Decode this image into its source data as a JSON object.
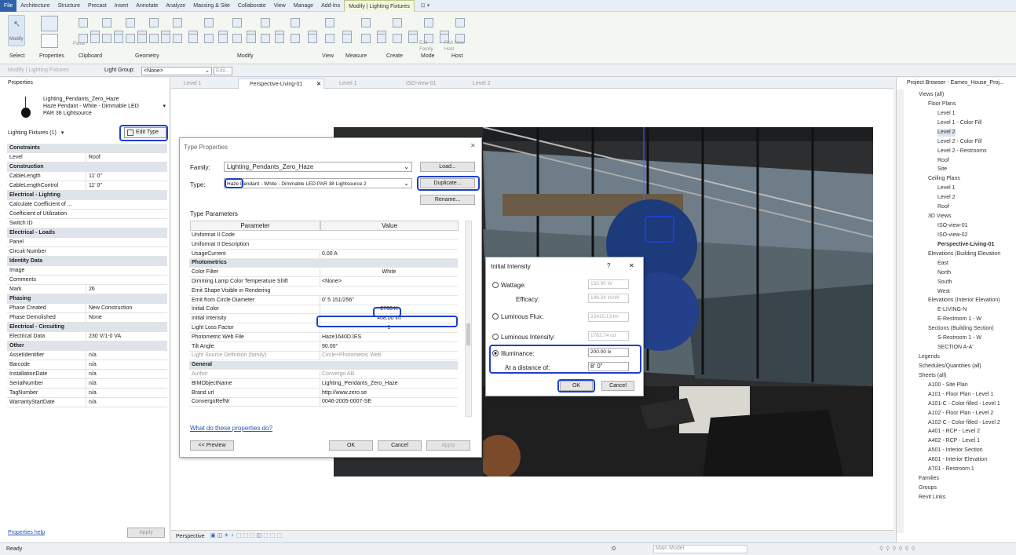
{
  "ribbon": {
    "tabs": [
      "File",
      "Architecture",
      "Structure",
      "Precast",
      "Insert",
      "Annotate",
      "Analyze",
      "Massing & Site",
      "Collaborate",
      "View",
      "Manage",
      "Add-Ins",
      "Modify | Lighting Fixtures"
    ],
    "panels": [
      "Select",
      "Properties",
      "Clipboard",
      "Geometry",
      "Modify",
      "View",
      "Measure",
      "Create",
      "Mode",
      "Host"
    ],
    "modify_label": "Modify",
    "paste_label": "Paste",
    "cope_label": "Cope",
    "cut_label": "Cut",
    "join_label": "Join",
    "edit_family_label": "Edit Family",
    "pick_host_label": "Pick New Host"
  },
  "optbar": {
    "context": "Modify | Lighting Fixtures",
    "light_group_label": "Light Group:",
    "light_group_value": "<None>",
    "edit_label": "Edit..."
  },
  "properties": {
    "title": "Properties",
    "family_line1": "Lighting_Pendants_Zero_Haze",
    "family_line2": "Haze Pendant - White - Dimmable LED",
    "family_line3": "PAR 38 Lightsource",
    "filter": "Lighting Fixtures (1)",
    "edit_type": "Edit Type",
    "rows": [
      {
        "k": "Constraints",
        "g": true
      },
      {
        "k": "Level",
        "v": "Roof"
      },
      {
        "k": "Construction",
        "g": true
      },
      {
        "k": "CableLength",
        "v": "11'  0\""
      },
      {
        "k": "CableLengthControl",
        "v": "11'  0\""
      },
      {
        "k": "Electrical - Lighting",
        "g": true
      },
      {
        "k": "Calculate Coefficient of ...",
        "v": ""
      },
      {
        "k": "Coefficient of Utilization",
        "v": ""
      },
      {
        "k": "Switch ID",
        "v": ""
      },
      {
        "k": "Electrical - Loads",
        "g": true
      },
      {
        "k": "Panel",
        "v": ""
      },
      {
        "k": "Circuit Number",
        "v": ""
      },
      {
        "k": "Identity Data",
        "g": true
      },
      {
        "k": "Image",
        "v": ""
      },
      {
        "k": "Comments",
        "v": ""
      },
      {
        "k": "Mark",
        "v": "26"
      },
      {
        "k": "Phasing",
        "g": true
      },
      {
        "k": "Phase Created",
        "v": "New Construction"
      },
      {
        "k": "Phase Demolished",
        "v": "None"
      },
      {
        "k": "Electrical - Circuiting",
        "g": true
      },
      {
        "k": "Electrical Data",
        "v": "230 V/1-0 VA"
      },
      {
        "k": "Other",
        "g": true
      },
      {
        "k": "AssetIdentifier",
        "v": "n/a"
      },
      {
        "k": "Barcode",
        "v": "n/a"
      },
      {
        "k": "InstallationDate",
        "v": "n/a"
      },
      {
        "k": "SerialNumber",
        "v": "n/a"
      },
      {
        "k": "TagNumber",
        "v": "n/a"
      },
      {
        "k": "WarrantyStartDate",
        "v": "n/a"
      }
    ],
    "help": "Properties help",
    "apply": "Apply"
  },
  "view_tabs": [
    "Level 1",
    "Perspective-Living-01",
    "Level 1",
    "ISO-view-01",
    "Level 2"
  ],
  "type_props": {
    "title": "Type Properties",
    "family_label": "Family:",
    "family_value": "Lighting_Pendants_Zero_Haze",
    "type_label": "Type:",
    "type_value": "Haze Pendant - White - Dimmable LED PAR 38 Lightsource 2",
    "load": "Load...",
    "duplicate": "Duplicate...",
    "rename": "Rename...",
    "params_label": "Type Parameters",
    "col_param": "Parameter",
    "col_value": "Value",
    "rows": [
      {
        "k": "Uniformat II Code",
        "v": ""
      },
      {
        "k": "Uniformat II Description",
        "v": ""
      },
      {
        "k": "UsageCurrent",
        "v": "0.00 A"
      },
      {
        "k": "Photometrics",
        "v": "",
        "g": true
      },
      {
        "k": "Color Filter",
        "v": "White"
      },
      {
        "k": "Dimming Lamp Color Temperature Shift",
        "v": "<None>"
      },
      {
        "k": "Emit Shape Visible in Rendering",
        "v": ""
      },
      {
        "k": "Emit from Circle Diameter",
        "v": "0'  5 151/256\""
      },
      {
        "k": "Initial Color",
        "v": "2700 K"
      },
      {
        "k": "Initial Intensity",
        "v": "468.00 lm"
      },
      {
        "k": "Light Loss Factor",
        "v": "1"
      },
      {
        "k": "Photometric Web File",
        "v": "Haze1640D.IES"
      },
      {
        "k": "Tilt Angle",
        "v": "90.00°"
      },
      {
        "k": "Light Source Definition (family)",
        "v": "Circle+Photometric Web",
        "d": true
      },
      {
        "k": "General",
        "v": "",
        "g": true
      },
      {
        "k": "Author",
        "v": "Convergo AB",
        "d": true
      },
      {
        "k": "BIMObjectName",
        "v": "Lighting_Pendants_Zero_Haze"
      },
      {
        "k": "Brand url",
        "v": "http://www.zero.se"
      },
      {
        "k": "ConvergoRefNr",
        "v": "0046-2005-0007-SE"
      }
    ],
    "what_link": "What do these properties do?",
    "preview": "<< Preview",
    "ok": "OK",
    "cancel": "Cancel",
    "apply": "Apply"
  },
  "intensity": {
    "title": "Initial Intensity",
    "help": "?",
    "close": "✕",
    "wattage_label": "Wattage:",
    "wattage_value": "150.90 W",
    "efficacy_label": "Efficacy:",
    "efficacy_value": "148.34 lm/W",
    "flux_label": "Luminous Flux:",
    "flux_value": "22415.13 lm",
    "lint_label": "Luminous Intensity:",
    "lint_value": "1783.74 cd",
    "illum_label": "Illuminance:",
    "illum_value": "200.00 lx",
    "distance_label": "At a distance of:",
    "distance_value": "8'  0\"",
    "ok": "OK",
    "cancel": "Cancel"
  },
  "browser": {
    "title": "Project Browser - Eames_House_Proj...",
    "items": [
      {
        "t": "Views (all)",
        "i": 0
      },
      {
        "t": "Floor Plans",
        "i": 1
      },
      {
        "t": "Level 1",
        "i": 2
      },
      {
        "t": "Level 1 - Color Fill",
        "i": 2
      },
      {
        "t": "Level 2",
        "i": 2,
        "s": true
      },
      {
        "t": "Level 2 - Color Fill",
        "i": 2
      },
      {
        "t": "Level 2 - Restrooms",
        "i": 2
      },
      {
        "t": "Roof",
        "i": 2
      },
      {
        "t": "Site",
        "i": 2
      },
      {
        "t": "Ceiling Plans",
        "i": 1
      },
      {
        "t": "Level 1",
        "i": 2
      },
      {
        "t": "Level 2",
        "i": 2
      },
      {
        "t": "Roof",
        "i": 2
      },
      {
        "t": "3D Views",
        "i": 1
      },
      {
        "t": "ISO-view-01",
        "i": 2
      },
      {
        "t": "ISO-view-02",
        "i": 2
      },
      {
        "t": "Perspective-Living-01",
        "i": 2,
        "b": true
      },
      {
        "t": "Elevations (Building Elevation",
        "i": 1
      },
      {
        "t": "East",
        "i": 2
      },
      {
        "t": "North",
        "i": 2
      },
      {
        "t": "South",
        "i": 2
      },
      {
        "t": "West",
        "i": 2
      },
      {
        "t": "Elevations (Interior Elevation)",
        "i": 1
      },
      {
        "t": "E-LIVING-N",
        "i": 2
      },
      {
        "t": "E-Restroom 1 - W",
        "i": 2
      },
      {
        "t": "Sections (Building Section)",
        "i": 1
      },
      {
        "t": "S-Restroom 1 - W",
        "i": 2
      },
      {
        "t": "SECTION A-A'",
        "i": 2
      },
      {
        "t": "Legends",
        "i": 0
      },
      {
        "t": "Schedules/Quantities (all)",
        "i": 0
      },
      {
        "t": "Sheets (all)",
        "i": 0
      },
      {
        "t": "A100 - Site Plan",
        "i": 1
      },
      {
        "t": "A101 - Floor Plan - Level 1",
        "i": 1
      },
      {
        "t": "A101-C - Color filled - Level 1",
        "i": 1
      },
      {
        "t": "A102 - Floor Plan - Level 2",
        "i": 1
      },
      {
        "t": "A102-C - Color filled - Level 2",
        "i": 1
      },
      {
        "t": "A401 - RCP - Level 2",
        "i": 1
      },
      {
        "t": "A402 - RCP - Level 1",
        "i": 1
      },
      {
        "t": "A501 - Interior Section",
        "i": 1
      },
      {
        "t": "A601 - Interior Elevation",
        "i": 1
      },
      {
        "t": "A701 - Restroom 1",
        "i": 1
      },
      {
        "t": "Families",
        "i": 0
      },
      {
        "t": "Groups",
        "i": 0
      },
      {
        "t": "Revit Links",
        "i": 0
      }
    ]
  },
  "view_control": {
    "mode": "Perspective"
  },
  "status": {
    "text": "Ready",
    "model": "Main Model",
    "zero": ":0"
  }
}
